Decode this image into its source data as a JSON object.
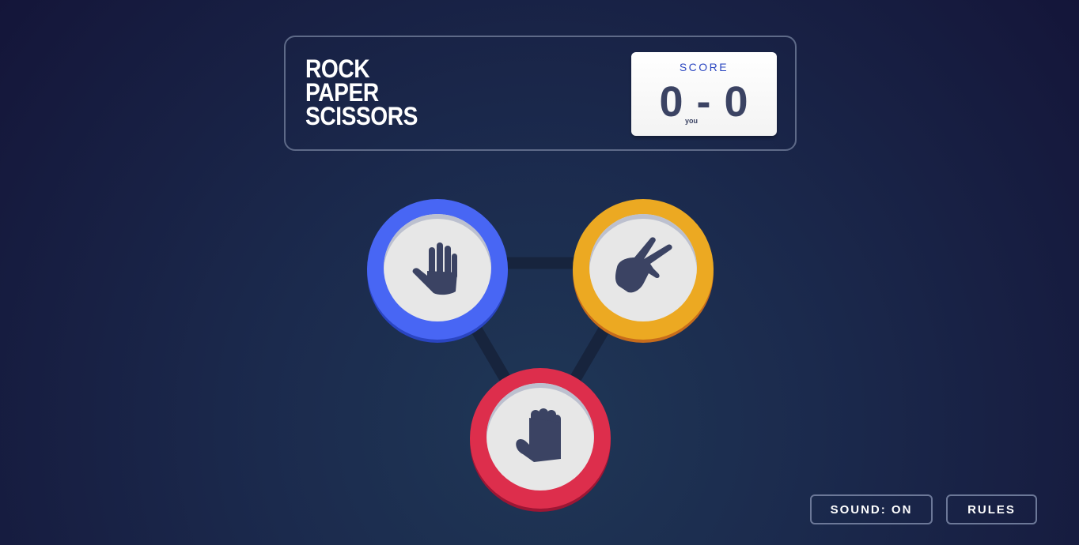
{
  "header": {
    "title_lines": [
      "ROCK",
      "PAPER",
      "SCISSORS"
    ],
    "score": {
      "label": "SCORE",
      "display": "0 - 0",
      "player_score": 0,
      "computer_score": 0,
      "player_tag": "you"
    }
  },
  "tokens": [
    {
      "choice": "paper",
      "icon": "paper-hand-icon",
      "ring_color": "#4866f4"
    },
    {
      "choice": "scissors",
      "icon": "scissors-hand-icon",
      "ring_color": "#eca922"
    },
    {
      "choice": "rock",
      "icon": "rock-fist-icon",
      "ring_color": "#dd2e4c"
    }
  ],
  "controls": {
    "sound_label": "SOUND: ON",
    "rules_label": "RULES"
  },
  "colors": {
    "background": "#1b2a4d",
    "icon": "#3b4363",
    "score_label": "#2a46c0"
  }
}
